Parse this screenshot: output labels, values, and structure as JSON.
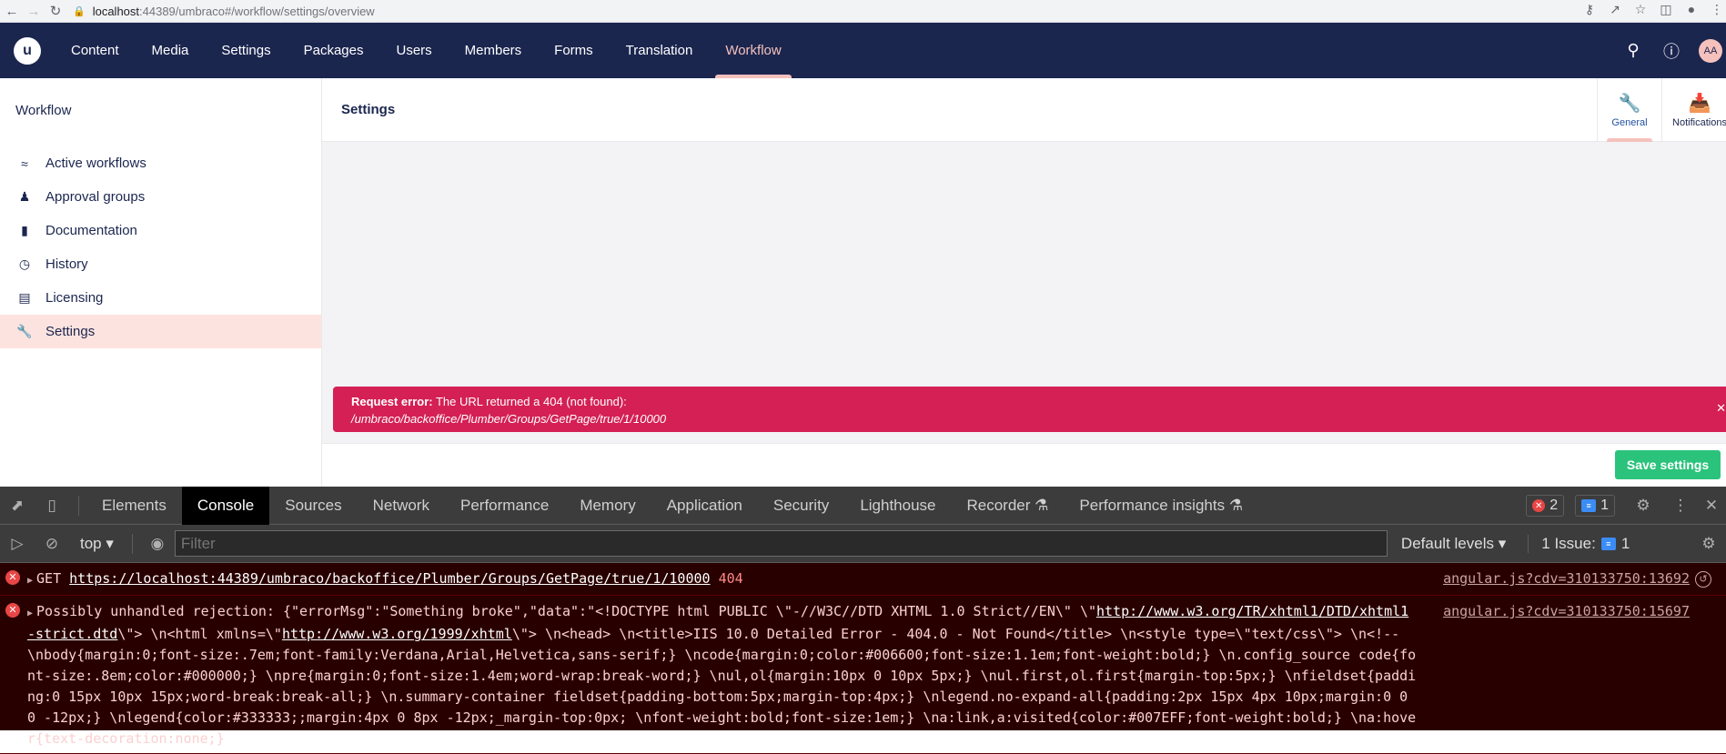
{
  "browser": {
    "url_host": "localhost",
    "url_path": ":44389/umbraco#/workflow/settings/overview"
  },
  "header": {
    "logo": "u",
    "sections": [
      "Content",
      "Media",
      "Settings",
      "Packages",
      "Users",
      "Members",
      "Forms",
      "Translation",
      "Workflow"
    ],
    "active_section": "Workflow",
    "avatar_initials": "AA"
  },
  "tree": {
    "title": "Workflow",
    "items": [
      {
        "label": "Active workflows",
        "icon": "workflow-icon"
      },
      {
        "label": "Approval groups",
        "icon": "users-icon"
      },
      {
        "label": "Documentation",
        "icon": "book-icon"
      },
      {
        "label": "History",
        "icon": "clock-icon"
      },
      {
        "label": "Licensing",
        "icon": "license-icon"
      },
      {
        "label": "Settings",
        "icon": "wrench-icon"
      }
    ],
    "selected": "Settings"
  },
  "main": {
    "title": "Settings",
    "apps": [
      {
        "label": "General",
        "icon": "wrench-icon"
      },
      {
        "label": "Notifications",
        "icon": "inbox-icon"
      }
    ],
    "error": {
      "prefix": "Request error:",
      "message": "The URL returned a 404 (not found):",
      "path": "/umbraco/backoffice/Plumber/Groups/GetPage/true/1/10000"
    },
    "save_label": "Save settings"
  },
  "devtools": {
    "tabs": [
      "Elements",
      "Console",
      "Sources",
      "Network",
      "Performance",
      "Memory",
      "Application",
      "Security",
      "Lighthouse",
      "Recorder",
      "Performance insights"
    ],
    "active_tab": "Console",
    "error_count": "2",
    "message_count": "1",
    "context": "top",
    "filter_placeholder": "Filter",
    "levels": "Default levels",
    "issues_label": "1 Issue:",
    "issues_count": "1",
    "rows": [
      {
        "method": "GET",
        "url": "https://localhost:44389/umbraco/backoffice/Plumber/Groups/GetPage/true/1/10000",
        "status": "404",
        "source": "angular.js?cdv=310133750:13692"
      },
      {
        "text_a": "Possibly unhandled rejection: {\"errorMsg\":\"Something broke\",\"data\":\"<!DOCTYPE html PUBLIC \\\"-//W3C//DTD XHTML 1.0 Strict//EN\\\" \\\"",
        "link_a": "http://www.w3.org/TR/xhtml1/DTD/xhtml1-strict.dtd",
        "text_b": "\\\"> \\n<html xmlns=\\\"",
        "link_b": "http://www.w3.org/1999/xhtml",
        "text_c": "\\\"> \\n<head> \\n<title>IIS 10.0 Detailed Error - 404.0 - Not Found</title> \\n<style type=\\\"text/css\\\"> \\n<!-- \\nbody{margin:0;font-size:.7em;font-family:Verdana,Arial,Helvetica,sans-serif;} \\ncode{margin:0;color:#006600;font-size:1.1em;font-weight:bold;} \\n.config_source code{font-size:.8em;color:#000000;} \\npre{margin:0;font-size:1.4em;word-wrap:break-word;} \\nul,ol{margin:10px 0 10px 5px;} \\nul.first,ol.first{margin-top:5px;} \\nfieldset{padding:0 15px 10px 15px;word-break:break-all;} \\n.summary-container fieldset{padding-bottom:5px;margin-top:4px;} \\nlegend.no-expand-all{padding:2px 15px 4px 10px;margin:0 0 0 -12px;} \\nlegend{color:#333333;;margin:4px 0 8px -12px;_margin-top:0px; \\nfont-weight:bold;font-size:1em;} \\na:link,a:visited{color:#007EFF;font-weight:bold;} \\na:hover{text-decoration:none;}",
        "source": "angular.js?cdv=310133750:15697"
      }
    ]
  }
}
